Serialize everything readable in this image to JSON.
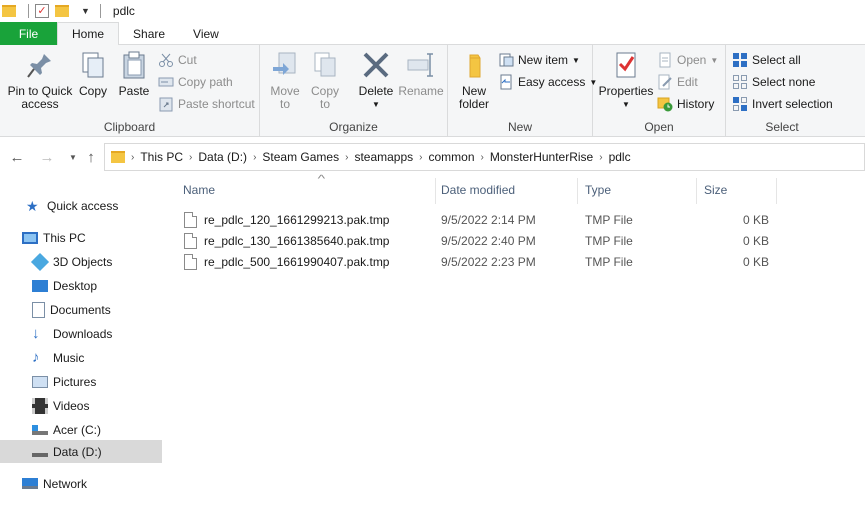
{
  "window": {
    "title": "pdlc"
  },
  "tabs": [
    {
      "label": "File"
    },
    {
      "label": "Home"
    },
    {
      "label": "Share"
    },
    {
      "label": "View"
    }
  ],
  "ribbon": {
    "clipboard": {
      "label": "Clipboard",
      "pin_line1": "Pin to Quick",
      "pin_line2": "access",
      "copy": "Copy",
      "paste": "Paste",
      "cut": "Cut",
      "copy_path": "Copy path",
      "paste_shortcut": "Paste shortcut"
    },
    "organize": {
      "label": "Organize",
      "move_line1": "Move",
      "move_line2": "to",
      "copy_line1": "Copy",
      "copy_line2": "to",
      "delete": "Delete",
      "rename": "Rename"
    },
    "new": {
      "label": "New",
      "new_folder_line1": "New",
      "new_folder_line2": "folder",
      "new_item": "New item",
      "easy_access": "Easy access"
    },
    "open": {
      "label": "Open",
      "properties": "Properties",
      "open": "Open",
      "edit": "Edit",
      "history": "History"
    },
    "select": {
      "label": "Select",
      "select_all": "Select all",
      "select_none": "Select none",
      "invert_selection": "Invert selection"
    }
  },
  "address": {
    "crumbs": [
      "This PC",
      "Data (D:)",
      "Steam Games",
      "steamapps",
      "common",
      "MonsterHunterRise",
      "pdlc"
    ]
  },
  "navpane": {
    "quick_access": "Quick access",
    "this_pc": "This PC",
    "objects3d": "3D Objects",
    "desktop": "Desktop",
    "documents": "Documents",
    "downloads": "Downloads",
    "music": "Music",
    "pictures": "Pictures",
    "videos": "Videos",
    "acer": "Acer (C:)",
    "data": "Data (D:)",
    "network": "Network"
  },
  "filelist": {
    "columns": {
      "name": "Name",
      "date": "Date modified",
      "type": "Type",
      "size": "Size"
    },
    "rows": [
      {
        "name": "re_pdlc_120_1661299213.pak.tmp",
        "date": "9/5/2022 2:14 PM",
        "type": "TMP File",
        "size": "0 KB"
      },
      {
        "name": "re_pdlc_130_1661385640.pak.tmp",
        "date": "9/5/2022 2:40 PM",
        "type": "TMP File",
        "size": "0 KB"
      },
      {
        "name": "re_pdlc_500_1661990407.pak.tmp",
        "date": "9/5/2022 2:23 PM",
        "type": "TMP File",
        "size": "0 KB"
      }
    ]
  },
  "colors": {
    "file_tab": "#19a33a",
    "folder": "#f4c542",
    "selection": "#d9d9d9",
    "header_text": "#4c607a"
  }
}
